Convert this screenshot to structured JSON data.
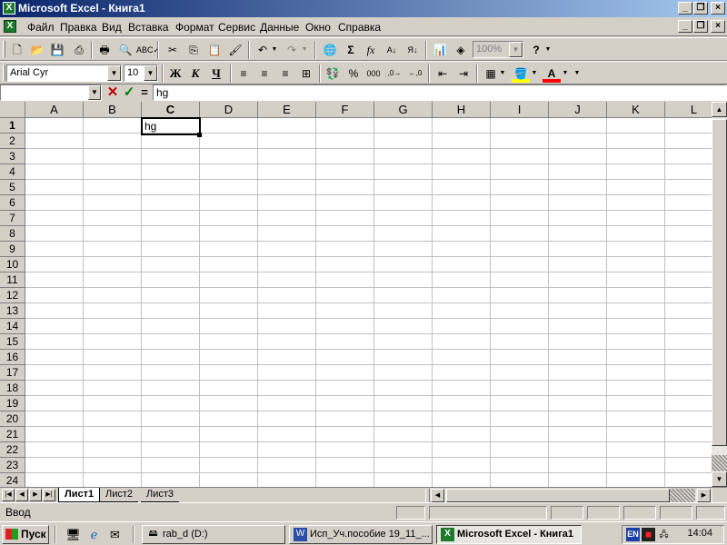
{
  "window": {
    "title": "Microsoft Excel - Книга1"
  },
  "menu": {
    "items": [
      "Файл",
      "Правка",
      "Вид",
      "Вставка",
      "Формат",
      "Сервис",
      "Данные",
      "Окно",
      "Справка"
    ]
  },
  "toolbar_standard": {
    "zoom": "100%",
    "icons": [
      "new-icon",
      "open-icon",
      "save-icon",
      "permission-icon",
      "print-icon",
      "print-preview-icon",
      "spelling-icon",
      "cut-icon",
      "copy-icon",
      "paste-icon",
      "format-painter-icon",
      "undo-icon",
      "redo-icon",
      "hyperlink-icon",
      "autosum-icon",
      "function-icon",
      "sort-ascending-icon",
      "sort-descending-icon",
      "chart-wizard-icon",
      "drawing-icon",
      "help-icon"
    ]
  },
  "toolbar_formatting": {
    "font": "Arial Cyr",
    "size": "10",
    "bold": "Ж",
    "italic": "К",
    "underline": "Ч",
    "percent": "%",
    "thousands": "000"
  },
  "formula_bar": {
    "name_box": "",
    "equals": "=",
    "value": "hg"
  },
  "grid": {
    "columns": [
      "A",
      "B",
      "C",
      "D",
      "E",
      "F",
      "G",
      "H",
      "I",
      "J",
      "K",
      "L"
    ],
    "rows": [
      "1",
      "2",
      "3",
      "4",
      "5",
      "6",
      "7",
      "8",
      "9",
      "10",
      "11",
      "12",
      "13",
      "14",
      "15",
      "16",
      "17",
      "18",
      "19",
      "20",
      "21",
      "22",
      "23",
      "24"
    ],
    "active_column": "C",
    "active_row": "1",
    "cells": [
      {
        "ref": "C1",
        "value": "hg"
      }
    ]
  },
  "sheet_tabs": [
    "Лист1",
    "Лист2",
    "Лист3"
  ],
  "status_bar": {
    "mode": "Ввод"
  },
  "taskbar": {
    "start": "Пуск",
    "tasks": [
      {
        "label": "rab_d (D:)",
        "icon": "drive-icon",
        "active": false
      },
      {
        "label": "Исп_Уч.пособие 19_11_...",
        "icon": "word-icon",
        "active": false
      },
      {
        "label": "Microsoft Excel - Книга1",
        "icon": "excel-icon",
        "active": true
      }
    ],
    "language": "EN",
    "clock": "14:04"
  },
  "colors": {
    "title_start": "#0a246a",
    "title_end": "#a6caf0",
    "chrome": "#d4d0c8",
    "excel_green": "#1e7a2c"
  }
}
